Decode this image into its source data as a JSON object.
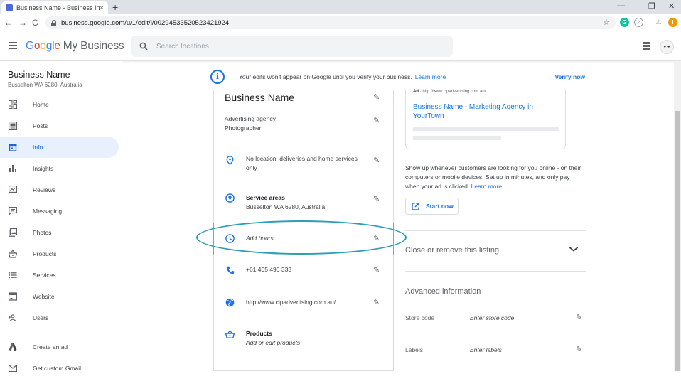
{
  "browser": {
    "tab_title": "Business Name - Business Info",
    "tab_close": "×",
    "new_tab": "+",
    "url": "business.google.com/u/1/edit/l/00294533520523421924",
    "win_min": "—",
    "win_max": "❐",
    "win_close": "✕",
    "back": "←",
    "forward": "→",
    "reload": "C",
    "star": "☆"
  },
  "header": {
    "logo_google": [
      "G",
      "o",
      "o",
      "g",
      "l",
      "e"
    ],
    "logo_product": "My Business",
    "search_placeholder": "Search locations"
  },
  "sidebar": {
    "business_name": "Business Name",
    "business_address": "Busselton WA 6280, Australia",
    "items": [
      {
        "label": "Home",
        "icon": "home-dashboard-icon"
      },
      {
        "label": "Posts",
        "icon": "posts-icon"
      },
      {
        "label": "Info",
        "icon": "storefront-icon",
        "active": true
      },
      {
        "label": "Insights",
        "icon": "bar-chart-icon"
      },
      {
        "label": "Reviews",
        "icon": "reviews-icon"
      },
      {
        "label": "Messaging",
        "icon": "message-icon"
      },
      {
        "label": "Photos",
        "icon": "photos-icon"
      },
      {
        "label": "Products",
        "icon": "basket-icon"
      },
      {
        "label": "Services",
        "icon": "list-icon"
      },
      {
        "label": "Website",
        "icon": "website-icon"
      },
      {
        "label": "Users",
        "icon": "add-user-icon"
      }
    ],
    "secondary_items": [
      {
        "label": "Create an ad",
        "icon": "google-ads-icon"
      },
      {
        "label": "Get custom Gmail",
        "icon": "mail-icon"
      }
    ]
  },
  "banner": {
    "message": "Your edits won't appear on Google until you verify your business.",
    "learn_more": "Learn more",
    "verify": "Verify now"
  },
  "info_card": {
    "name": "Business Name",
    "categories": [
      "Advertising agency",
      "Photographer"
    ],
    "location": "No location; deliveries and home services only",
    "service_areas_title": "Service areas",
    "service_areas_value": "Busselton WA 6280, Australia",
    "hours": "Add hours",
    "phone": "+61 405 496 333",
    "website": "http://www.clpadvertising.com.au/",
    "products_title": "Products",
    "products_value": "Add or edit products"
  },
  "ad_preview": {
    "badge": "Ad",
    "url": "http://www.clpadvertising.com.au/",
    "title": "Business Name - Marketing Agency in YourTown",
    "promo_text": "Show up whenever customers are looking for you online - on their computers or mobile devices. Set up in minutes, and only pay when your ad is clicked.",
    "promo_learn": "Learn more",
    "start_now": "Start now"
  },
  "close_listing": "Close or remove this listing",
  "advanced": {
    "title": "Advanced information",
    "store_code_label": "Store code",
    "store_code_value": "Enter store code",
    "labels_label": "Labels",
    "labels_value": "Enter labels"
  },
  "colors": {
    "accent": "#1a73e8",
    "annotation_ellipse": "#2a9db8",
    "active_nav_bg": "#e8f0fe"
  }
}
